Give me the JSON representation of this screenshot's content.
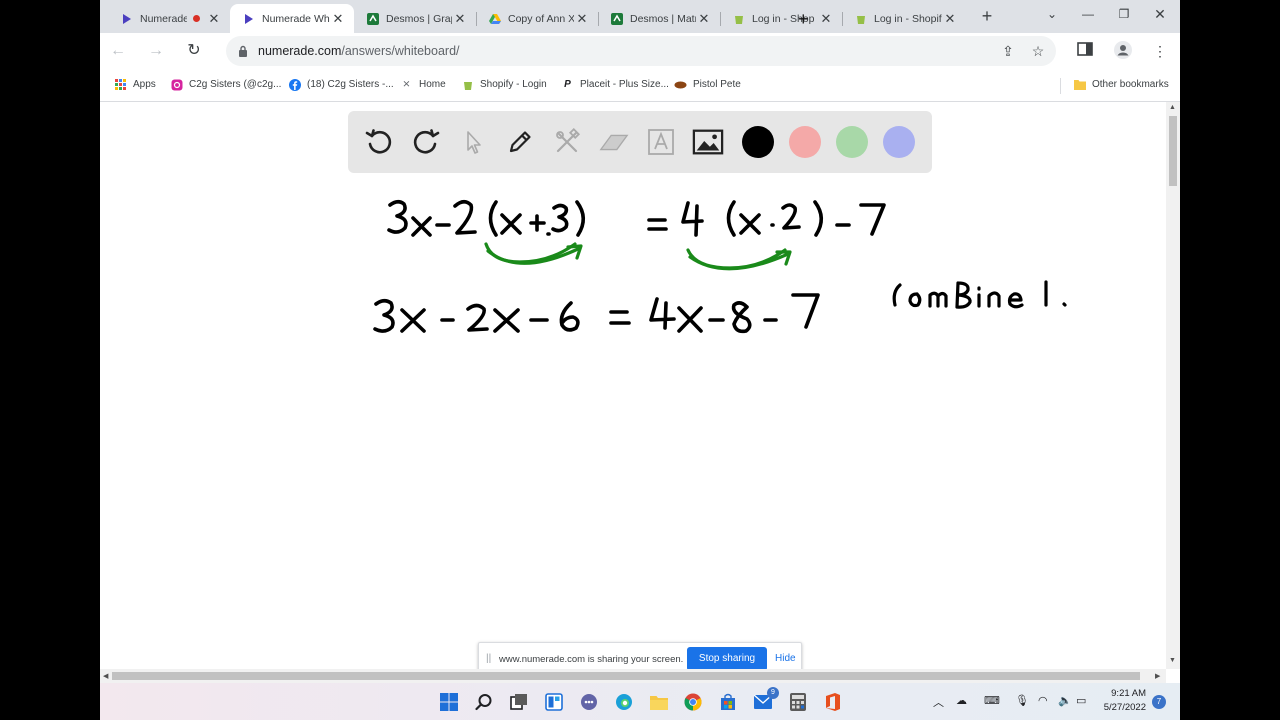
{
  "browser": {
    "tabs": [
      {
        "title": "Numerade",
        "icon": "numerade-icon",
        "recording": true
      },
      {
        "title": "Numerade Wh",
        "icon": "numerade-icon",
        "active": true
      },
      {
        "title": "Desmos | Grap",
        "icon": "desmos-icon"
      },
      {
        "title": "Copy of Ann X",
        "icon": "google-drive-icon"
      },
      {
        "title": "Desmos | Matr",
        "icon": "desmos-icon"
      },
      {
        "title": "Log in - Shop",
        "icon": "shopify-icon"
      },
      {
        "title": "Log in - Shopif",
        "icon": "shopify-icon"
      }
    ],
    "url_host": "numerade.com",
    "url_path": "/answers/whiteboard/",
    "bookmarks": [
      {
        "label": "Apps",
        "icon": "apps-grid-icon"
      },
      {
        "label": "C2g Sisters (@c2g...",
        "icon": "instagram-icon"
      },
      {
        "label": "(18) C2g Sisters -...",
        "icon": "facebook-icon"
      },
      {
        "label": "Home",
        "icon": "desmos-home-icon"
      },
      {
        "label": "Shopify - Login",
        "icon": "shopify-icon"
      },
      {
        "label": "Placeit - Plus Size...",
        "icon": "placeit-icon"
      },
      {
        "label": "Pistol Pete",
        "icon": "pistol-pete-icon"
      }
    ],
    "other_bookmarks": "Other bookmarks"
  },
  "whiteboard": {
    "tools": [
      "undo-icon",
      "redo-icon",
      "select-pointer-icon",
      "pen-icon",
      "tools-icon",
      "eraser-icon",
      "text-icon",
      "image-icon"
    ],
    "colors": [
      "#000000",
      "#f4a9a8",
      "#a8d8a8",
      "#a9b0f0"
    ],
    "handwriting": {
      "line1": "3x-2(x+3)=4(x-2)-7",
      "line2": "3x-2x-6=4x-8-7",
      "note": "combine l."
    }
  },
  "sharing_bar": {
    "message": "www.numerade.com is sharing your screen.",
    "stop_label": "Stop sharing",
    "hide_label": "Hide"
  },
  "taskbar": {
    "time": "9:21 AM",
    "date": "5/27/2022",
    "mail_badge": "9",
    "notification_count": "7"
  }
}
